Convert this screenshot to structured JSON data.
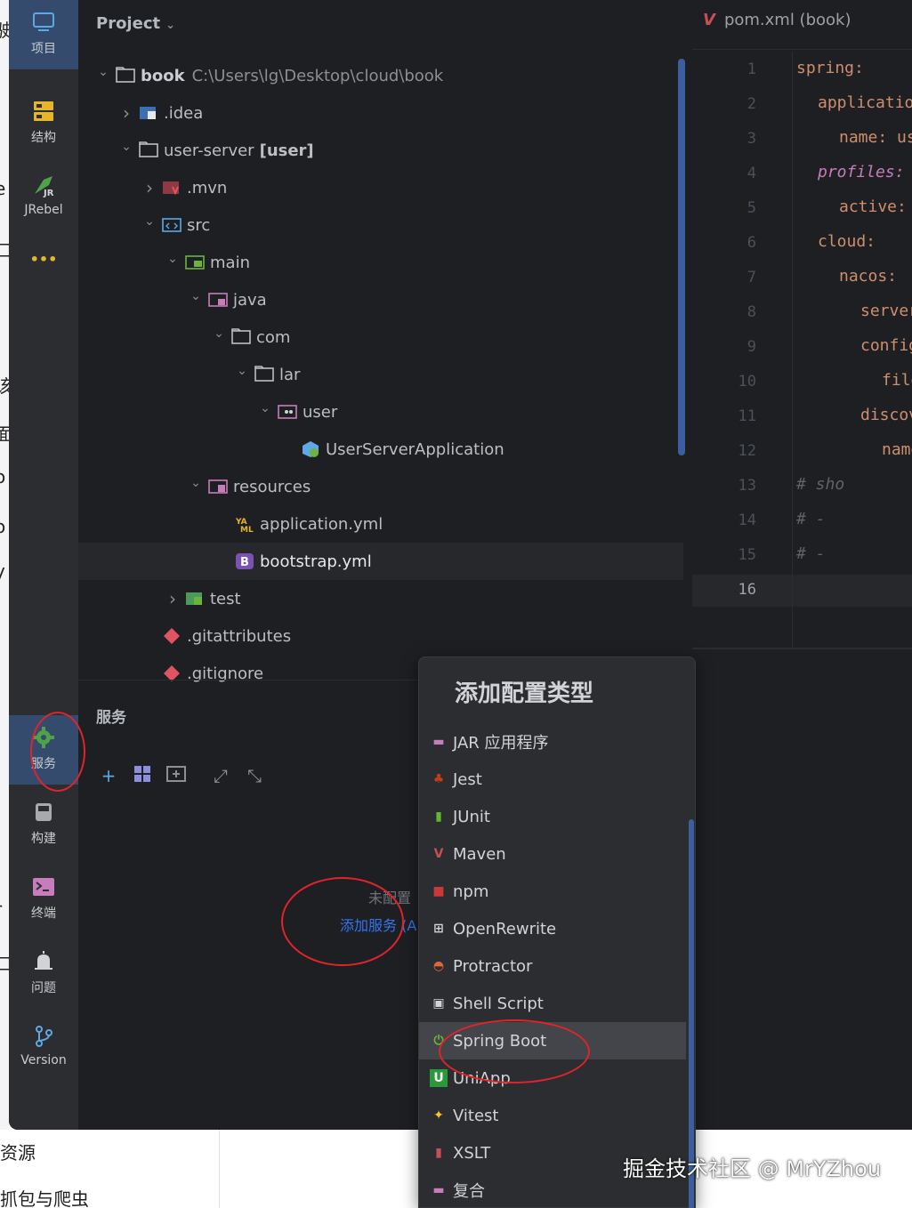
{
  "activity_bar": {
    "items": [
      {
        "label": "项目",
        "icon": "monitor-icon"
      },
      {
        "label": "结构",
        "icon": "structure-icon"
      },
      {
        "label": "JRebel",
        "icon": "rocket-icon"
      },
      {
        "label": "•••",
        "icon": "more-icon"
      },
      {
        "label": "服务",
        "icon": "gear-icon"
      },
      {
        "label": "构建",
        "icon": "build-icon"
      },
      {
        "label": "终端",
        "icon": "terminal-icon"
      },
      {
        "label": "问题",
        "icon": "bell-icon"
      },
      {
        "label": "Version",
        "icon": "branch-icon"
      }
    ]
  },
  "project_panel": {
    "title": "Project",
    "tree": [
      {
        "name": "book",
        "path": "C:\\Users\\lg\\Desktop\\cloud\\book",
        "bold": true
      },
      {
        "name": ".idea"
      },
      {
        "name": "user-server",
        "module": "[user]"
      },
      {
        "name": ".mvn"
      },
      {
        "name": "src"
      },
      {
        "name": "main"
      },
      {
        "name": "java"
      },
      {
        "name": "com"
      },
      {
        "name": "lar"
      },
      {
        "name": "user"
      },
      {
        "name": "UserServerApplication"
      },
      {
        "name": "resources"
      },
      {
        "name": "application.yml"
      },
      {
        "name": "bootstrap.yml"
      },
      {
        "name": "test"
      },
      {
        "name": ".gitattributes"
      },
      {
        "name": ".gitignore"
      }
    ]
  },
  "editor": {
    "tab": "pom.xml (book)",
    "line_numbers": [
      "1",
      "2",
      "3",
      "4",
      "5",
      "6",
      "7",
      "8",
      "9",
      "10",
      "11",
      "12",
      "13",
      "14",
      "15",
      "16"
    ],
    "lines": [
      {
        "text": "spring:",
        "cls": "k",
        "indent": 0
      },
      {
        "text": "applicatio",
        "cls": "k",
        "indent": 1
      },
      {
        "text": "name: us",
        "cls": "k",
        "indent": 2
      },
      {
        "text": "profiles:",
        "cls": "k it",
        "indent": 1
      },
      {
        "text": "active:",
        "cls": "k",
        "indent": 2
      },
      {
        "text": "cloud:",
        "cls": "k",
        "indent": 1
      },
      {
        "text": "nacos:",
        "cls": "k",
        "indent": 2
      },
      {
        "text": "server",
        "cls": "k",
        "indent": 3
      },
      {
        "text": "config",
        "cls": "k",
        "indent": 3
      },
      {
        "text": "file",
        "cls": "k",
        "indent": 4
      },
      {
        "text": "discov",
        "cls": "k",
        "indent": 3
      },
      {
        "text": "name",
        "cls": "k",
        "indent": 4
      },
      {
        "text": "#        sho",
        "cls": "cm",
        "indent": 0
      },
      {
        "text": "#           -",
        "cls": "cm",
        "indent": 0
      },
      {
        "text": "#           -",
        "cls": "cm",
        "indent": 0
      },
      {
        "text": "",
        "cls": "k",
        "indent": 0
      }
    ]
  },
  "services_panel": {
    "title": "服务",
    "empty_text": "未配置",
    "add_link": "添加服务 (A"
  },
  "popup": {
    "title": "添加配置类型",
    "items": [
      {
        "label": "JAR 应用程序",
        "icon": "jar-icon",
        "color": "#c77dbb"
      },
      {
        "label": "Jest",
        "icon": "jest-icon",
        "color": "#c63d14"
      },
      {
        "label": "JUnit",
        "icon": "junit-icon",
        "color": "#5fb832"
      },
      {
        "label": "Maven",
        "icon": "maven-icon",
        "color": "#c94f57"
      },
      {
        "label": "npm",
        "icon": "npm-icon",
        "color": "#cb3837"
      },
      {
        "label": "OpenRewrite",
        "icon": "openrewrite-icon",
        "color": "#d1d3d8"
      },
      {
        "label": "Protractor",
        "icon": "protractor-icon",
        "color": "#e2683c"
      },
      {
        "label": "Shell Script",
        "icon": "shell-icon",
        "color": "#d1d3d8"
      },
      {
        "label": "Spring Boot",
        "icon": "spring-boot-icon",
        "color": "#6db33f",
        "selected": true
      },
      {
        "label": "UniApp",
        "icon": "uniapp-icon",
        "color": "#2b9939"
      },
      {
        "label": "Vitest",
        "icon": "vitest-icon",
        "color": "#fcc72b"
      },
      {
        "label": "XSLT",
        "icon": "xslt-icon",
        "color": "#c94f57"
      },
      {
        "label": "复合",
        "icon": "compound-icon",
        "color": "#c77dbb"
      }
    ]
  },
  "background": {
    "left_chars": [
      "驶",
      "e",
      "口",
      "该",
      "面",
      "o",
      "o",
      "y",
      "r",
      "口"
    ],
    "bottom_lines": [
      "资源",
      "抓包与爬虫"
    ]
  },
  "watermark": "掘金技术社区 @ MrYZhou"
}
